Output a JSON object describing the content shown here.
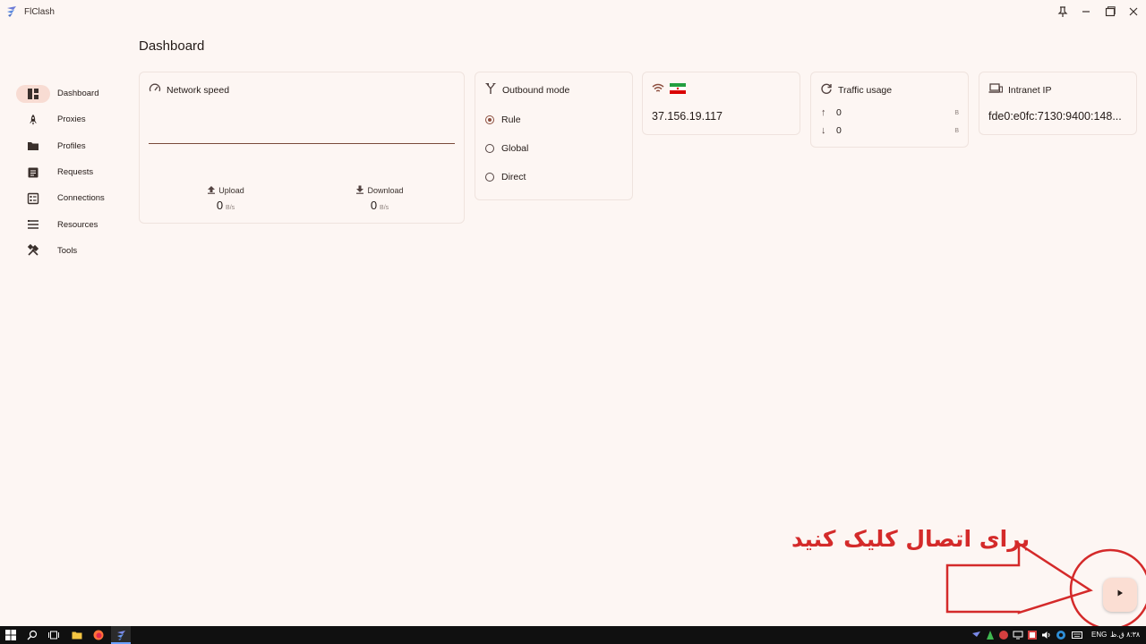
{
  "window": {
    "title": "FlClash"
  },
  "page": {
    "title": "Dashboard"
  },
  "sidebar": {
    "items": [
      {
        "label": "Dashboard",
        "icon": "dashboard-icon"
      },
      {
        "label": "Proxies",
        "icon": "rocket-icon"
      },
      {
        "label": "Profiles",
        "icon": "folder-icon"
      },
      {
        "label": "Requests",
        "icon": "list-doc-icon"
      },
      {
        "label": "Connections",
        "icon": "connections-icon"
      },
      {
        "label": "Resources",
        "icon": "resources-icon"
      },
      {
        "label": "Tools",
        "icon": "tools-icon"
      }
    ]
  },
  "network_speed": {
    "title": "Network speed",
    "upload_label": "Upload",
    "upload_value": "0",
    "upload_unit": "B/s",
    "download_label": "Download",
    "download_value": "0",
    "download_unit": "B/s"
  },
  "outbound_mode": {
    "title": "Outbound mode",
    "options": [
      "Rule",
      "Global",
      "Direct"
    ],
    "selected": "Rule"
  },
  "network_detection": {
    "ip": "37.156.19.117"
  },
  "traffic_usage": {
    "title": "Traffic usage",
    "up_value": "0",
    "up_unit": "B",
    "down_value": "0",
    "down_unit": "B"
  },
  "intranet_ip": {
    "title": "Intranet IP",
    "value": "fde0:e0fc:7130:9400:148..."
  },
  "annotation": {
    "text": "برای اتصال کلیک کنید"
  },
  "taskbar": {
    "lang": "ENG",
    "time": "۸:۳۸ ق.ظ"
  },
  "colors": {
    "accent": "#8d4f3f",
    "background": "#fdf6f3",
    "annotation_red": "#d42a2a",
    "nav_active_bg": "#f8dcd3"
  }
}
